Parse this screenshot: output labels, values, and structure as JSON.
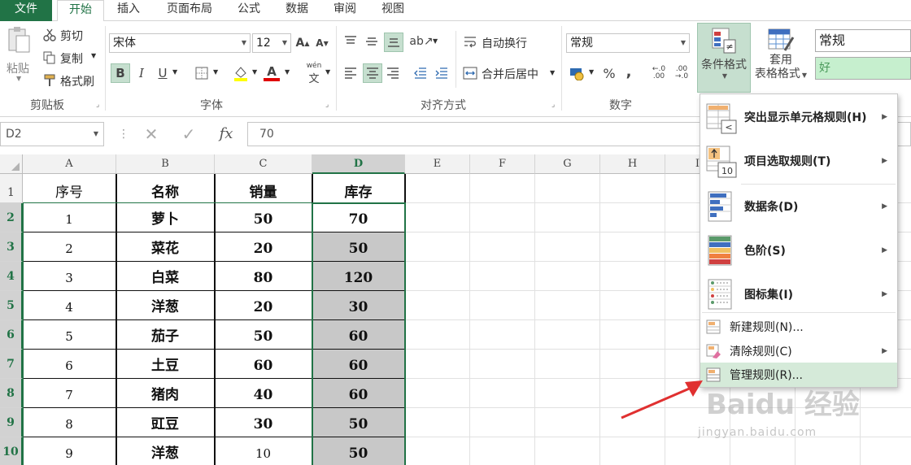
{
  "tabs": [
    "文件",
    "开始",
    "插入",
    "页面布局",
    "公式",
    "数据",
    "审阅",
    "视图"
  ],
  "clipboard": {
    "paste": "粘贴",
    "cut": "剪切",
    "copy": "复制",
    "format_painter": "格式刷",
    "group": "剪贴板"
  },
  "font": {
    "name": "宋体",
    "size": "12",
    "bold": "B",
    "italic": "I",
    "underline": "U",
    "phonetic": "wén",
    "group": "字体"
  },
  "alignment": {
    "wrap": "自动换行",
    "merge": "合并后居中",
    "group": "对齐方式"
  },
  "number": {
    "format": "常规",
    "percent": "%",
    "comma": ",",
    "group": "数字"
  },
  "styles": {
    "cond_format": "条件格式",
    "table_format_1": "套用",
    "table_format_2": "表格格式",
    "style_normal": "常规",
    "style_good": "好"
  },
  "formula_bar": {
    "cell_ref": "D2",
    "cancel": "✕",
    "enter": "✓",
    "fx": "fx",
    "value": "70"
  },
  "columns": [
    "A",
    "B",
    "C",
    "D",
    "E",
    "F",
    "G",
    "H",
    "I"
  ],
  "rows": [
    "1",
    "2",
    "3",
    "4",
    "5",
    "6",
    "7",
    "8",
    "9",
    "10"
  ],
  "table": {
    "headers": [
      "序号",
      "名称",
      "销量",
      "库存"
    ],
    "data": [
      [
        "1",
        "萝卜",
        "50",
        "70"
      ],
      [
        "2",
        "菜花",
        "20",
        "50"
      ],
      [
        "3",
        "白菜",
        "80",
        "120"
      ],
      [
        "4",
        "洋葱",
        "20",
        "30"
      ],
      [
        "5",
        "茄子",
        "50",
        "60"
      ],
      [
        "6",
        "土豆",
        "60",
        "60"
      ],
      [
        "7",
        "猪肉",
        "40",
        "60"
      ],
      [
        "8",
        "豇豆",
        "30",
        "50"
      ],
      [
        "9",
        "洋葱",
        "10",
        "50"
      ]
    ]
  },
  "menu": {
    "highlight_rules": "突出显示单元格规则(H)",
    "top_bottom": "项目选取规则(T)",
    "data_bars": "数据条(D)",
    "color_scales": "色阶(S)",
    "icon_sets": "图标集(I)",
    "new_rule": "新建规则(N)...",
    "clear_rules": "清除规则(C)",
    "manage_rules": "管理规则(R)..."
  },
  "watermark": {
    "main": "Baidu 经验",
    "sub": "jingyan.baidu.com"
  },
  "colors": {
    "accent": "#217346",
    "selected_fill": "#c8c8c8",
    "good_style": "#c6efce",
    "menu_hover": "#d5ead9"
  }
}
